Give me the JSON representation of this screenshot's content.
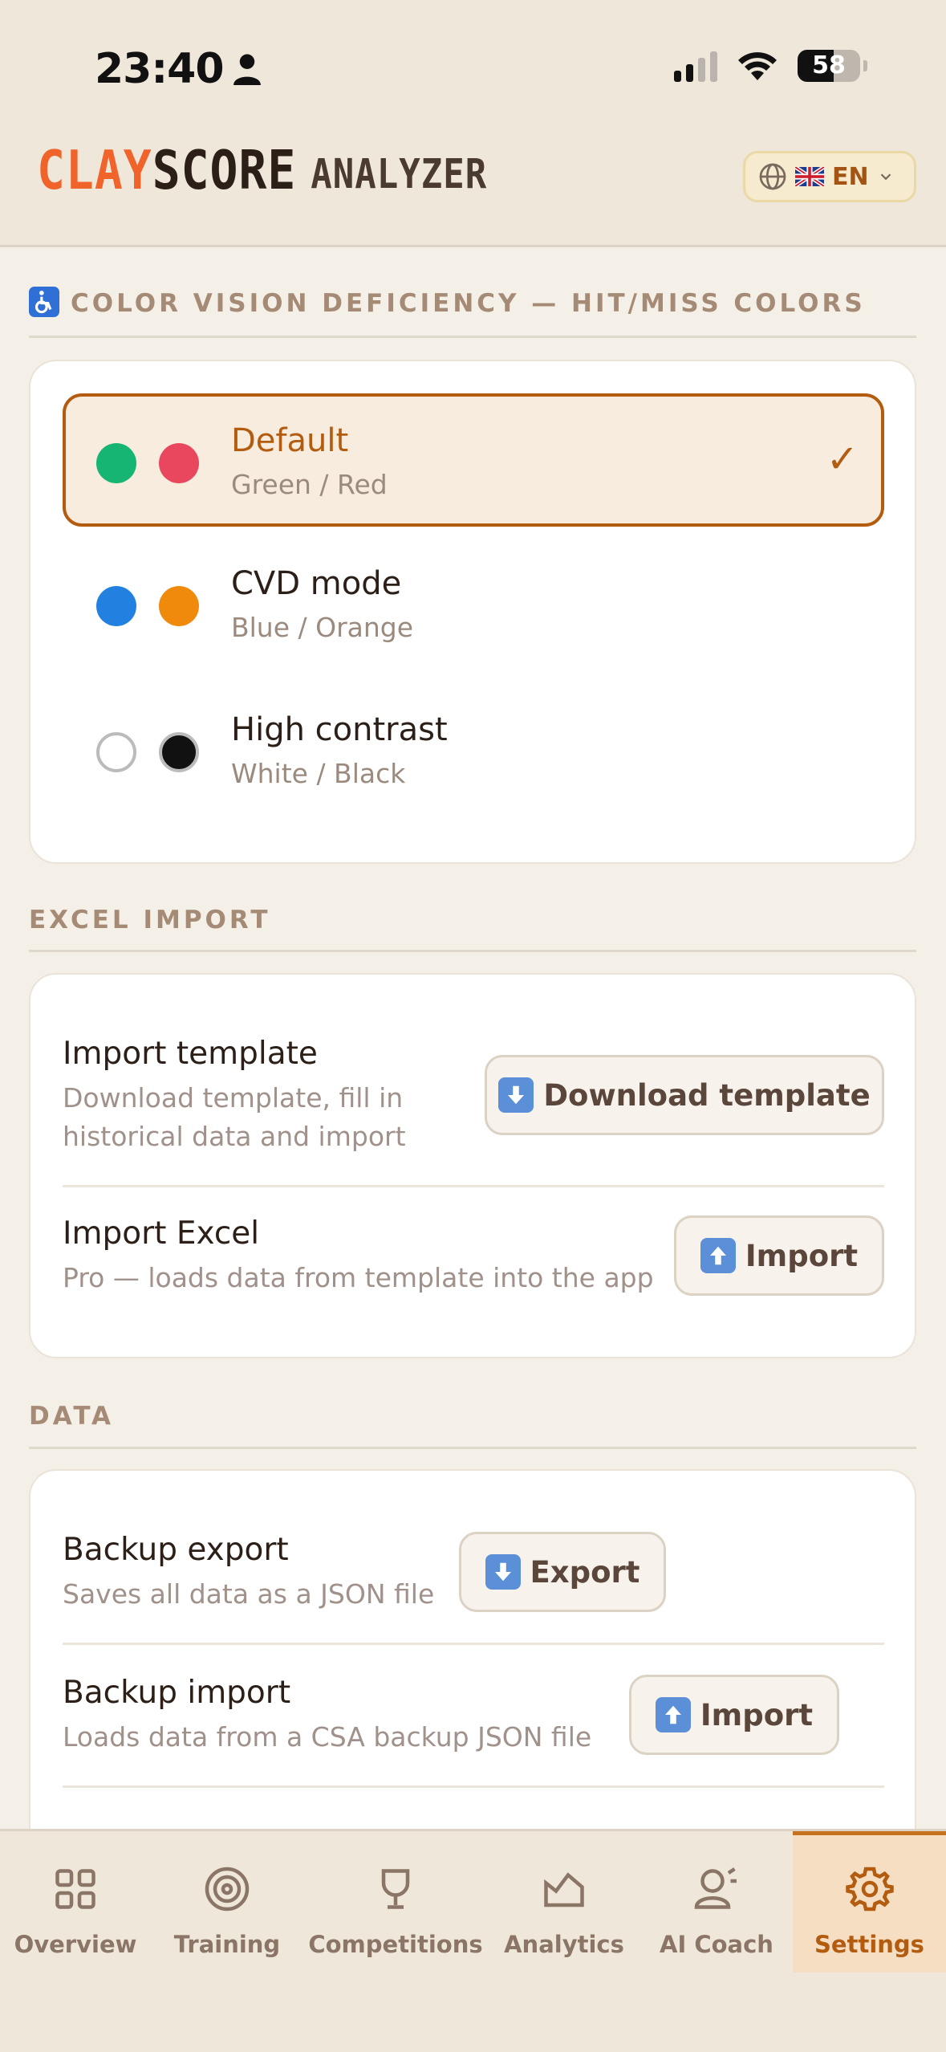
{
  "status": {
    "time": "23:40",
    "battery": 58
  },
  "header": {
    "logo_part1": "CLAY",
    "logo_part2": "SCORE",
    "logo_part3": "ANALYZER",
    "lang": "EN"
  },
  "cvd": {
    "title": "COLOR VISION DEFICIENCY — HIT/MISS COLORS",
    "options": [
      {
        "label": "Default",
        "sub": "Green / Red",
        "hit": "#17b574",
        "miss": "#e8475e",
        "selected": true
      },
      {
        "label": "CVD mode",
        "sub": "Blue / Orange",
        "hit": "#2280e0",
        "miss": "#f08a0c",
        "selected": false
      },
      {
        "label": "High contrast",
        "sub": "White / Black",
        "hit": "#ffffff",
        "miss": "#111111",
        "selected": false
      }
    ],
    "check": "✓"
  },
  "excel": {
    "title": "EXCEL IMPORT",
    "rows": [
      {
        "title": "Import template",
        "sub1": "Download template, fill in",
        "sub2": "historical data and import",
        "button": "Download template"
      },
      {
        "title": "Import Excel",
        "sub1": "Pro — loads data from template into the app",
        "button": "Import"
      }
    ]
  },
  "data_section": {
    "title": "DATA",
    "rows": [
      {
        "title": "Backup export",
        "sub": "Saves all data as a JSON file",
        "button": "Export"
      },
      {
        "title": "Backup import",
        "sub": "Loads data from a CSA backup JSON file",
        "button": "Import"
      }
    ]
  },
  "nav": [
    {
      "label": "Overview",
      "icon": "grid-icon"
    },
    {
      "label": "Training",
      "icon": "target-icon"
    },
    {
      "label": "Competitions",
      "icon": "trophy-icon"
    },
    {
      "label": "Analytics",
      "icon": "chart-icon"
    },
    {
      "label": "AI Coach",
      "icon": "coach-icon"
    },
    {
      "label": "Settings",
      "icon": "gear-icon",
      "active": true
    }
  ]
}
